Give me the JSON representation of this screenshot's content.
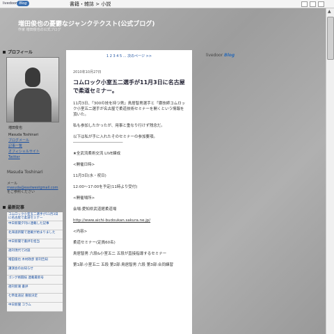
{
  "browser": {
    "brand": "livedoor",
    "brand_pill": "Blog",
    "breadcrumb": "書籍・雑誌 > 小説"
  },
  "blog": {
    "title": "増田俊也の憂鬱なジャンクテクスト(公式ブログ)",
    "subtitle": "作家 増田俊也の公式ブログ",
    "livedoor_logo": "livedoor",
    "livedoor_logo_blog": "Blog"
  },
  "sidebar": {
    "profile_heading": "プロフィール",
    "profile_name_jp": "増田俊也",
    "profile_name_en": "Masuda Toshinari",
    "link_mail": "ブログメール",
    "link_posts": "記事一覧",
    "link_official": "オフィシャルサイト",
    "link_twitter": "Twitter",
    "owner_name": "Masuda Toshinari",
    "mail_label": "メール",
    "mail_address": "masuda@eastwestgmail.com",
    "mail_note": "をご参照ください",
    "recent_heading": "最新記事",
    "recent_items": [
      "コムロック小室五二選手が11月3日に名古屋で柔道セミナー",
      "中日新聞夕刊に連載した記事",
      "北海道新聞で連載が始まりました",
      "中日新聞で書評を担当",
      "週刊現代で対談",
      "増田俊也 木村政彦 新刊告知",
      "講演会のお知らせ",
      "ゴング格闘技 連載最新号",
      "週刊新潮 書評",
      "七帝柔道記 重版決定",
      "中日新聞 コラム"
    ]
  },
  "main": {
    "pager": "1 2 3 4 5 ... 次のページ >>",
    "post_date": "2010年10月27日",
    "post_title": "コムロック小室五二選手が11月3日に名古屋で柔道セミナー。",
    "para1": "11月3日、「300の技を持つ男」鳥居智男選手と「寝技師コムロック小室五二選手が名古屋で柔道技術セミナーを開くという情報を頂いた。",
    "para2": "私も参加したかったが、用事と重なり行けず残念だ。",
    "para3": "以下は私が手に入れたそのセミナーの参加要項。",
    "divider": "―――――――――――――",
    "para4": "★全武流柔術交流 LIVE練成",
    "para5": "<開催日時>",
    "para6": "11月3日(水・祝日)",
    "para7": "12:00～17:00を予定(11時より受付)",
    "para8": "<開催場所>",
    "para9": "会場:愛知県武道館柔道場",
    "para10": "http://www.aichi-budoukan.sakura.ne.jp/",
    "para11": "<内容>",
    "para12": "柔道セミナー(定員60名)",
    "para13": "鳥居智男 六段&小室五二 五段が直接指導するセミナー",
    "para14": "第1部:小室五二 五段 第2部:鳥居智男 六段 第3部:合同練習"
  }
}
